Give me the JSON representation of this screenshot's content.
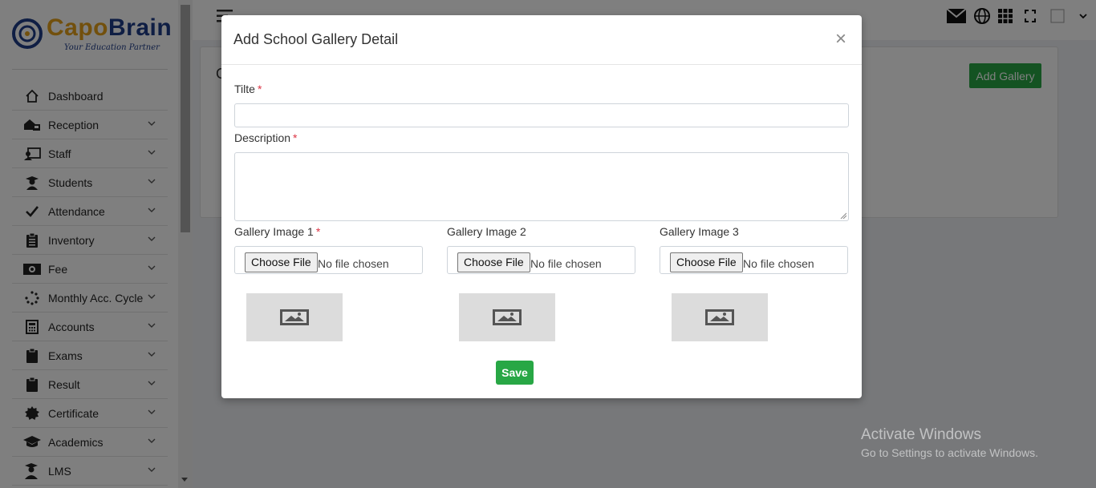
{
  "brand": {
    "name_part1": "Capo",
    "name_part2": "Brain",
    "tagline": "Your Education Partner"
  },
  "sidebar": {
    "items": [
      {
        "label": "Dashboard",
        "icon": "home-icon",
        "has_submenu": false
      },
      {
        "label": "Reception",
        "icon": "reception-icon",
        "has_submenu": true
      },
      {
        "label": "Staff",
        "icon": "staff-icon",
        "has_submenu": true
      },
      {
        "label": "Students",
        "icon": "student-icon",
        "has_submenu": true
      },
      {
        "label": "Attendance",
        "icon": "check-icon",
        "has_submenu": true
      },
      {
        "label": "Inventory",
        "icon": "clipboard-icon",
        "has_submenu": true
      },
      {
        "label": "Fee",
        "icon": "money-icon",
        "has_submenu": true
      },
      {
        "label": "Monthly Acc. Cycle",
        "icon": "spinner-icon",
        "has_submenu": true
      },
      {
        "label": "Accounts",
        "icon": "calculator-icon",
        "has_submenu": true
      },
      {
        "label": "Exams",
        "icon": "clipboard-icon",
        "has_submenu": true
      },
      {
        "label": "Result",
        "icon": "clipboard-icon",
        "has_submenu": true
      },
      {
        "label": "Certificate",
        "icon": "certificate-icon",
        "has_submenu": true
      },
      {
        "label": "Academics",
        "icon": "graduation-cap-icon",
        "has_submenu": true
      },
      {
        "label": "LMS",
        "icon": "teacher-icon",
        "has_submenu": true
      }
    ]
  },
  "page": {
    "card_title_fragment": "G",
    "add_gallery_label": "Add Gallery"
  },
  "modal": {
    "title": "Add School Gallery Detail",
    "close_glyph": "×",
    "title_label": "Tilte",
    "description_label": "Description",
    "required_mark": "*",
    "title_value": "",
    "description_value": "",
    "images": [
      {
        "label": "Gallery Image 1",
        "required": true,
        "button": "Choose File",
        "status": "No file chosen"
      },
      {
        "label": "Gallery Image 2",
        "required": false,
        "button": "Choose File",
        "status": "No file chosen"
      },
      {
        "label": "Gallery Image 3",
        "required": false,
        "button": "Choose File",
        "status": "No file chosen"
      }
    ],
    "save_label": "Save"
  },
  "watermark": {
    "line1": "Activate Windows",
    "line2": "Go to Settings to activate Windows."
  },
  "colors": {
    "brand_orange": "#e4a11b",
    "brand_blue": "#1f3c88",
    "button_green": "#28a745",
    "required_red": "#dc3545"
  }
}
